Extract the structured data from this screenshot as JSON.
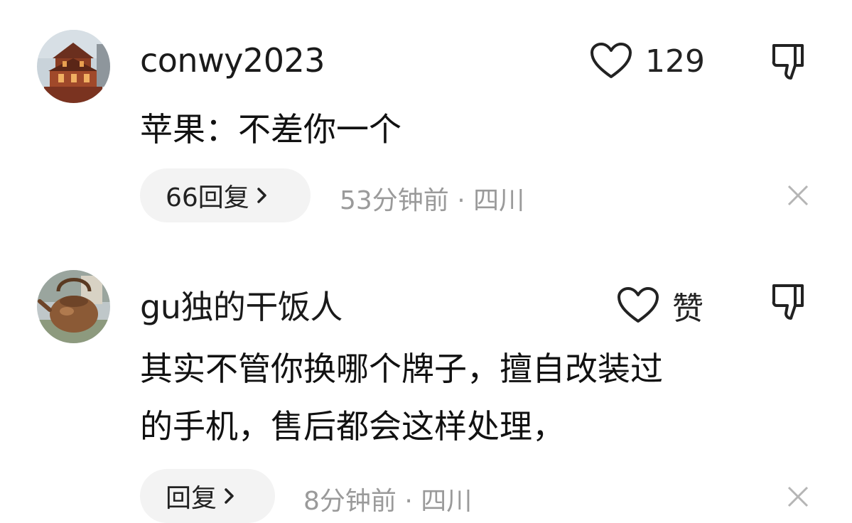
{
  "comments": [
    {
      "username": "conwy2023",
      "likes": "129",
      "content_lines": [
        "苹果：不差你一个"
      ],
      "reply_label": "66回复",
      "time": "53分钟前",
      "separator": "·",
      "location": "四川"
    },
    {
      "username": "gu独的干饭人",
      "likes": "赞",
      "content_lines": [
        "其实不管你换哪个牌子，擅自改装过",
        "的手机，售后都会这样处理，"
      ],
      "reply_label": "回复",
      "time": "8分钟前",
      "separator": "·",
      "location": "四川"
    }
  ],
  "icons": {
    "like": "heart-outline-icon",
    "dislike": "thumbs-down-icon",
    "reply_arrow": "chevron-right-icon",
    "close": "close-icon"
  },
  "colors": {
    "text": "#111111",
    "meta": "#9a9a9a",
    "pill": "#f3f3f3",
    "icon": "#222222"
  }
}
